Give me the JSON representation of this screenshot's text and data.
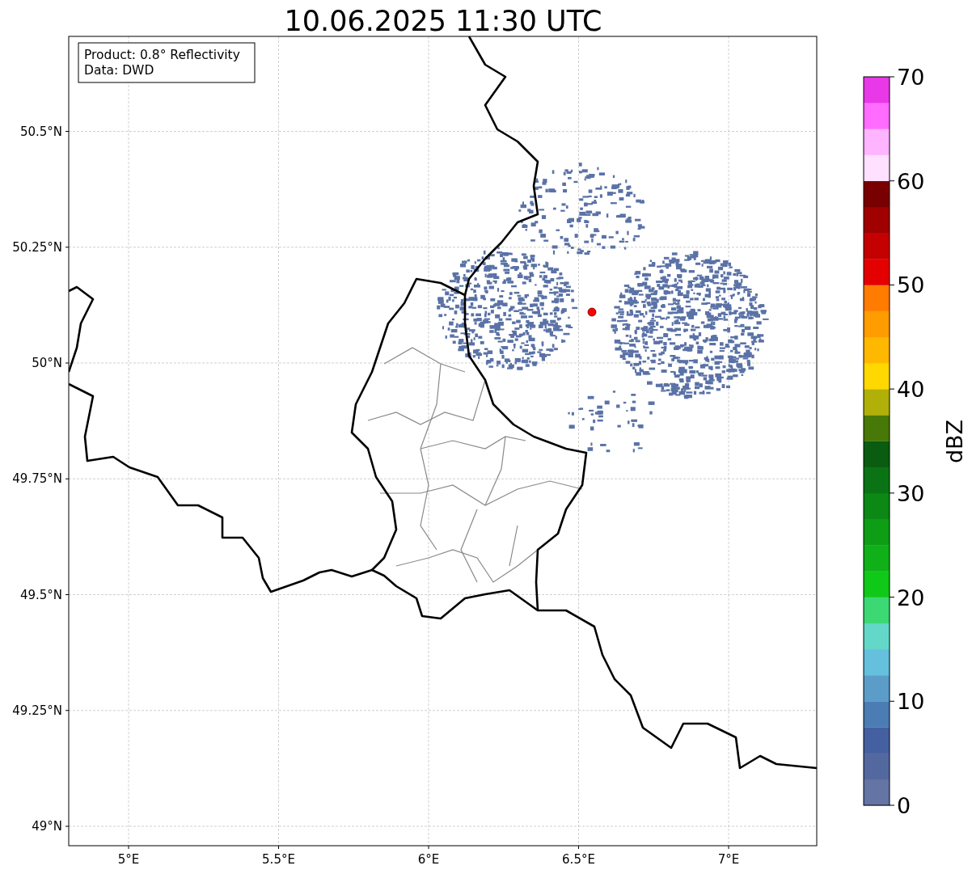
{
  "title": "10.06.2025 11:30 UTC",
  "info_box": [
    "Product: 0.8° Reflectivity",
    "Data: DWD"
  ],
  "map": {
    "lat_ticks": [
      "50.5°N",
      "50.25°N",
      "50°N",
      "49.75°N",
      "49.5°N",
      "49.25°N",
      "49°N"
    ],
    "lon_ticks": [
      "5°E",
      "5.5°E",
      "6°E",
      "6.5°E",
      "7°E"
    ]
  },
  "colorbar": {
    "label": "dBZ",
    "ticks": [
      "70",
      "60",
      "50",
      "40",
      "30",
      "20",
      "10",
      "0"
    ],
    "bins": [
      {
        "color": "#6474a4"
      },
      {
        "color": "#5468a0"
      },
      {
        "color": "#4460a0"
      },
      {
        "color": "#4c7cb4"
      },
      {
        "color": "#5c9cc8"
      },
      {
        "color": "#64c0dc"
      },
      {
        "color": "#64d8c8"
      },
      {
        "color": "#3cd874"
      },
      {
        "color": "#10c818"
      },
      {
        "color": "#10b018"
      },
      {
        "color": "#0e9e16"
      },
      {
        "color": "#0c8814"
      },
      {
        "color": "#0a7414"
      },
      {
        "color": "#0a5c10"
      },
      {
        "color": "#487808"
      },
      {
        "color": "#b0b008"
      },
      {
        "color": "#ffd800"
      },
      {
        "color": "#ffb800"
      },
      {
        "color": "#ff9c00"
      },
      {
        "color": "#ff7c00"
      },
      {
        "color": "#e40000"
      },
      {
        "color": "#c40000"
      },
      {
        "color": "#a00000"
      },
      {
        "color": "#780000"
      },
      {
        "color": "#ffe0ff"
      },
      {
        "color": "#ffb4ff"
      },
      {
        "color": "#ff6cff"
      },
      {
        "color": "#e838e8"
      }
    ]
  }
}
